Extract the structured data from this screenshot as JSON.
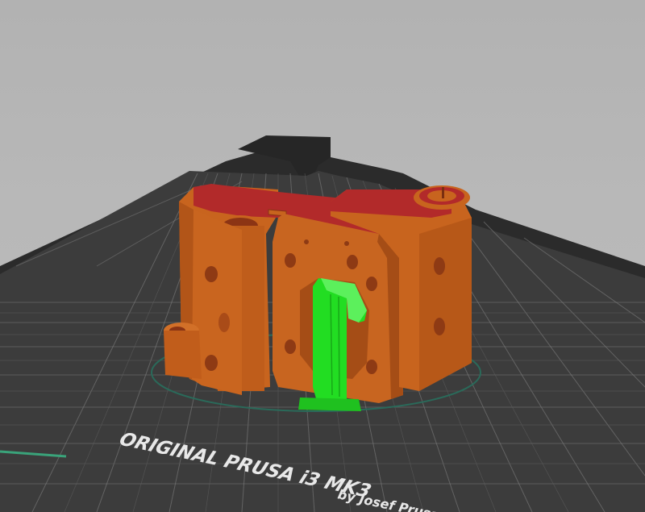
{
  "app": "PrusaSlicer 3D preview",
  "bed": {
    "logo_title": "ORIGINAL PRUSA i3 MK3",
    "logo_byline": "by Josef Prusa"
  },
  "colors": {
    "background": "#b6b6b6",
    "bed_surface": "#3a3a3a",
    "bed_grid": "#8a8a8a",
    "model_perimeter": "#c8641e",
    "model_top_solid": "#b22a2a",
    "support_material": "#22dd22",
    "skirt": "#2a6a5a",
    "progress_accent": "#3aa37a"
  }
}
